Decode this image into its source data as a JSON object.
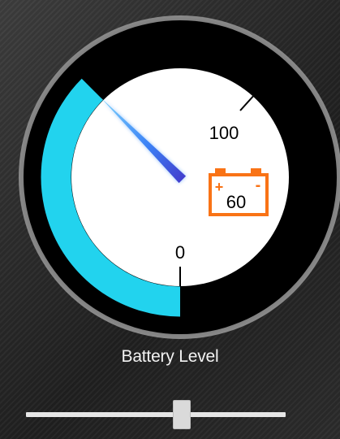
{
  "gauge": {
    "title": "Battery Level",
    "max_label": "100",
    "min_label": "0",
    "value_label": "60",
    "level_fraction": 0.6,
    "colors": {
      "arc": "#22d3ee",
      "ring": "#000000",
      "needle": "#4f46e5",
      "battery": "#f97316"
    },
    "icon": "battery-icon"
  },
  "slider": {
    "level_fraction": 0.6
  }
}
